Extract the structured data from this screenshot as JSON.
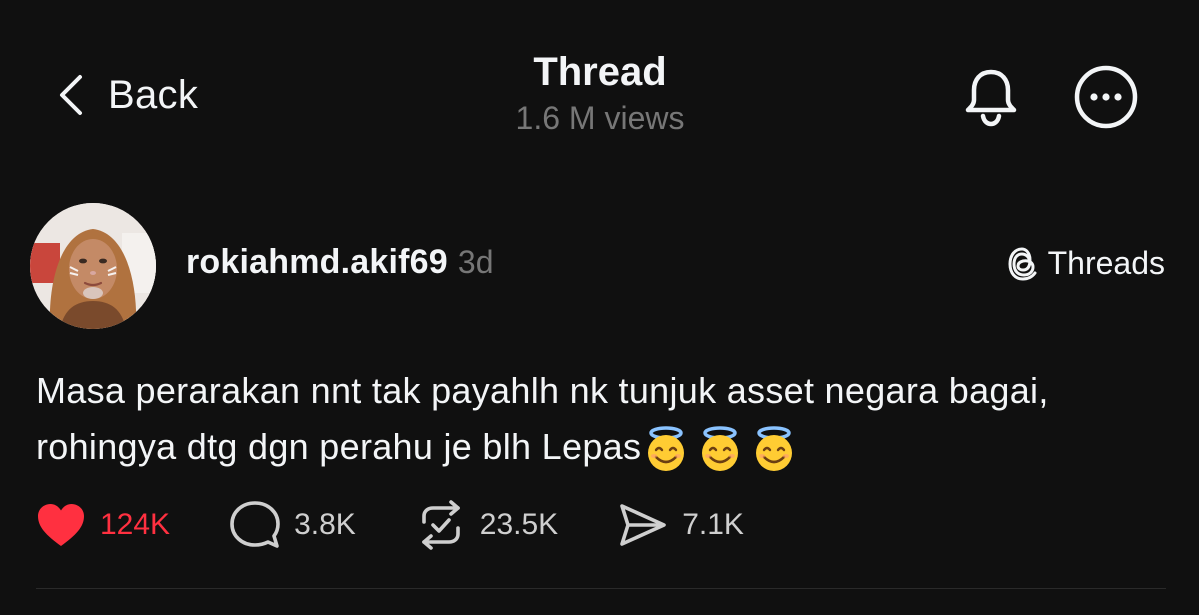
{
  "header": {
    "back_label": "Back",
    "title": "Thread",
    "views": "1.6 M views"
  },
  "icons": {
    "back": "chevron-left-icon",
    "bell": "bell-icon",
    "more": "more-icon",
    "threads": "threads-logo-icon",
    "like": "heart-icon",
    "comment": "comment-icon",
    "repost": "repost-icon",
    "share": "share-icon",
    "emoji": "smiling-face-with-halo-emoji"
  },
  "post": {
    "username": "rokiahmd.akif69",
    "time": "3d",
    "source_label": "Threads",
    "text_line1": "Masa perarakan nnt tak payahlh nk tunjuk asset negara bagai,",
    "text_line2": "rohingya dtg dgn perahu je blh Lepas",
    "emoji": "😇😇😇",
    "likes": "124K",
    "comments": "3.8K",
    "reposts": "23.5K",
    "shares": "7.1K",
    "liked": true
  },
  "colors": {
    "background": "#101010",
    "text": "#f3f5f7",
    "secondary_text": "#777777",
    "like_red": "#ff3040"
  }
}
